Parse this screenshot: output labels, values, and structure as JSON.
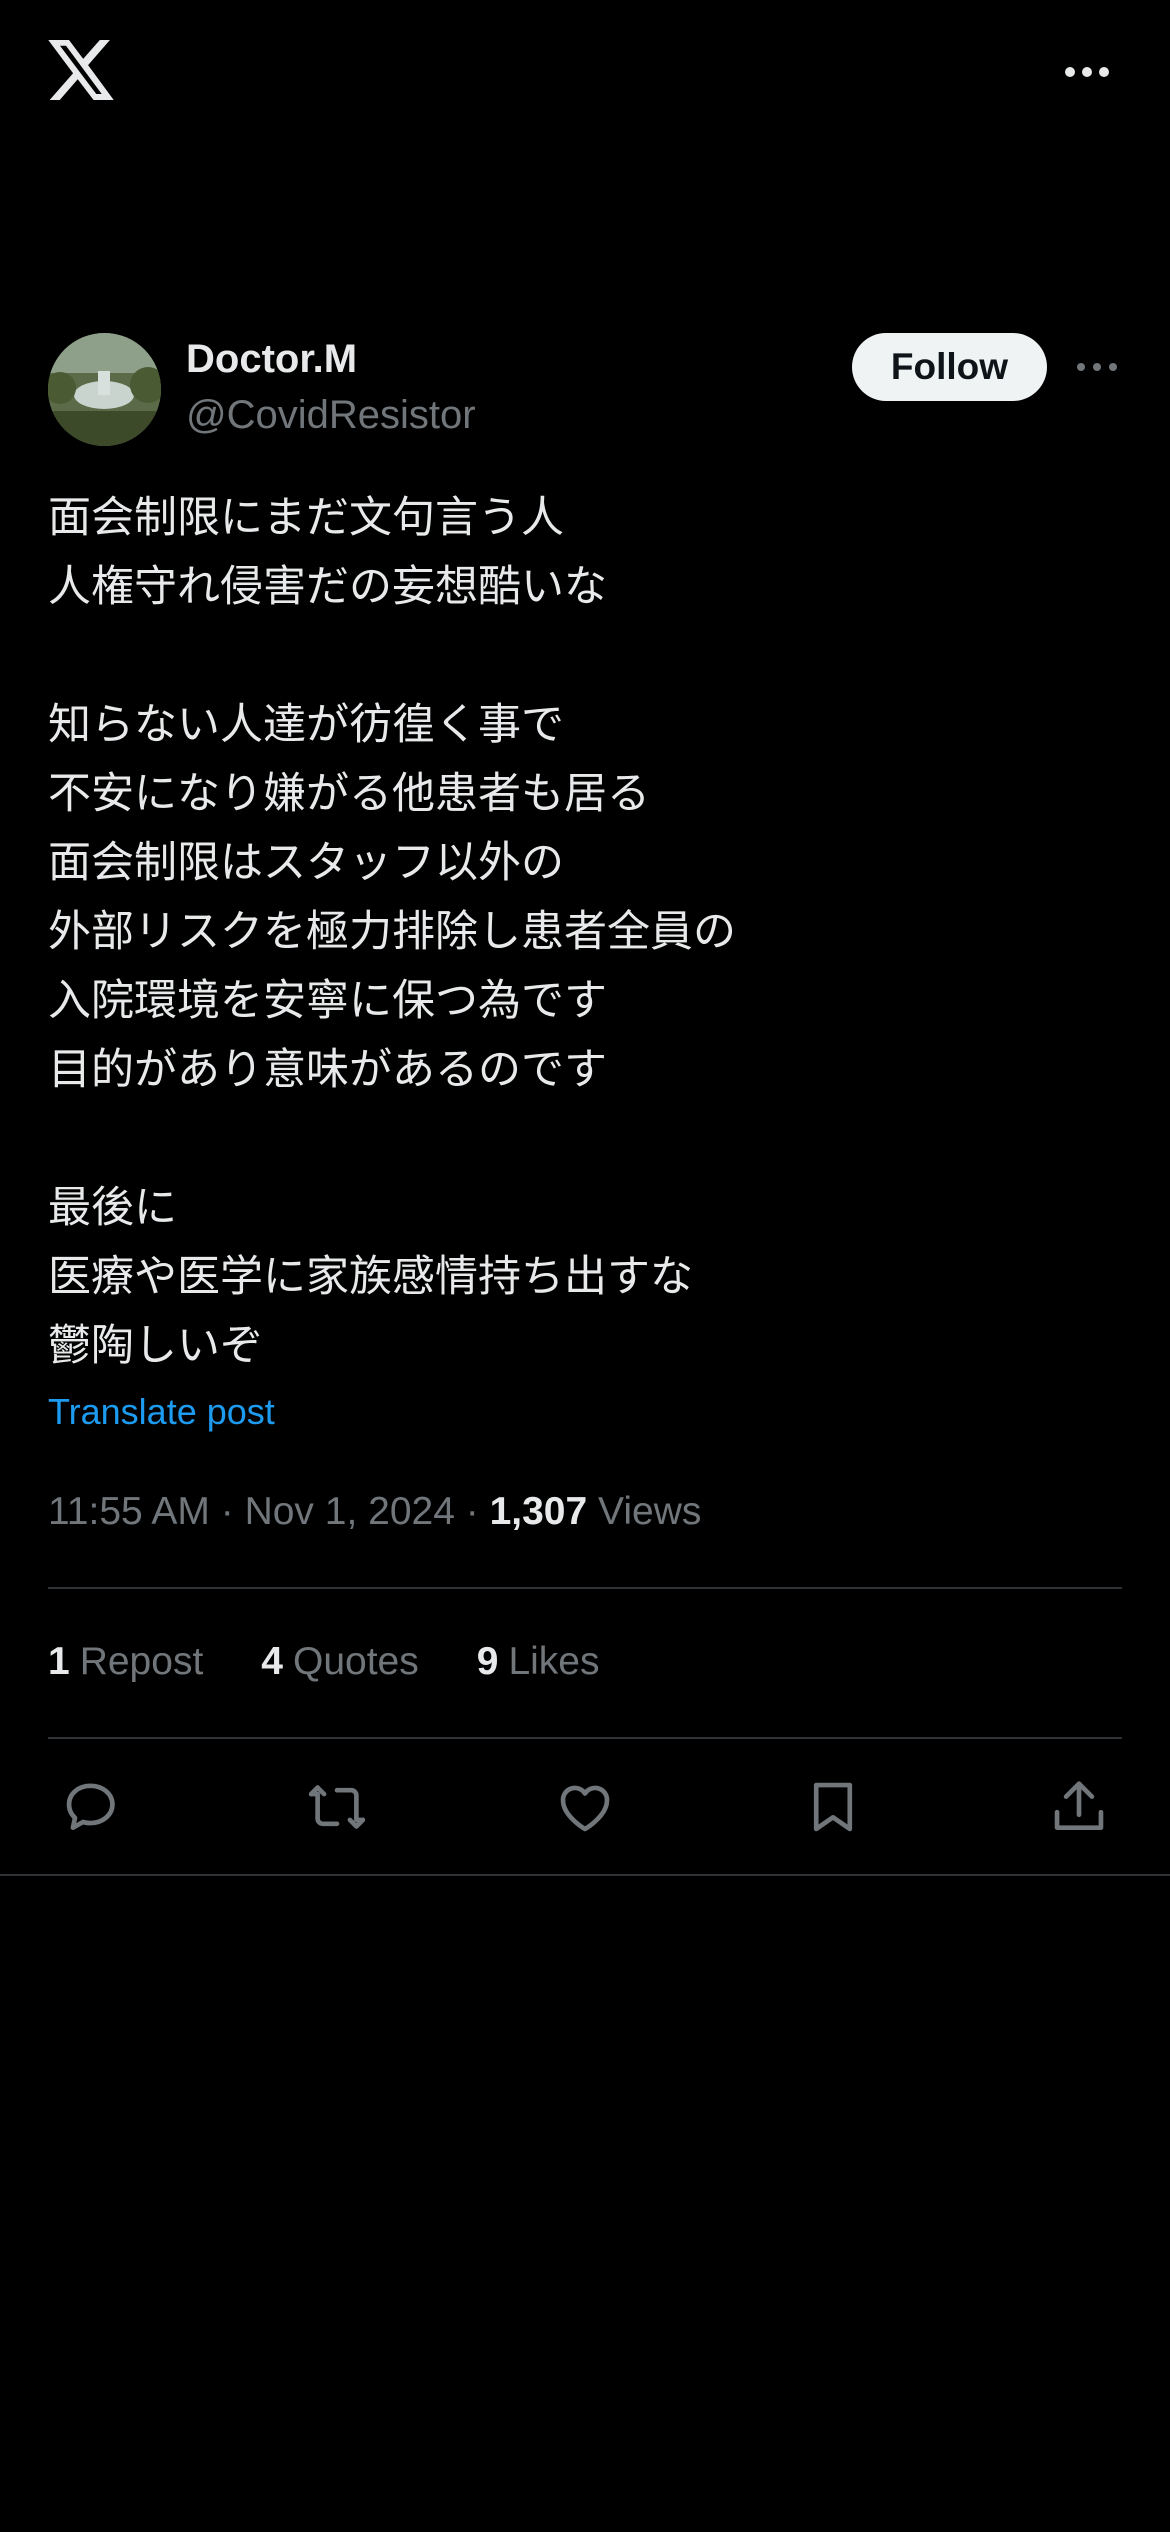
{
  "header": {
    "logo_icon": "x-logo-icon",
    "more_icon": "more-horizontal-icon"
  },
  "author": {
    "display_name": "Doctor.M",
    "handle": "@CovidResistor",
    "follow_label": "Follow"
  },
  "post": {
    "text": "面会制限にまだ文句言う人\n人権守れ侵害だの妄想酷いな\n\n知らない人達が彷徨く事で\n不安になり嫌がる他患者も居る\n面会制限はスタッフ以外の\n外部リスクを極力排除し患者全員の\n入院環境を安寧に保つ為です\n目的があり意味があるのです\n\n最後に\n医療や医学に家族感情持ち出すな\n鬱陶しいぞ",
    "translate_label": "Translate post",
    "time": "11:55 AM",
    "date": "Nov 1, 2024",
    "separator": "·",
    "views_count": "1,307",
    "views_label": "Views"
  },
  "stats": {
    "reposts_count": "1",
    "reposts_label": "Repost",
    "quotes_count": "4",
    "quotes_label": "Quotes",
    "likes_count": "9",
    "likes_label": "Likes"
  },
  "actions": [
    "reply-icon",
    "repost-icon",
    "like-icon",
    "bookmark-icon",
    "share-icon"
  ],
  "colors": {
    "background": "#000000",
    "text_primary": "#e7e9ea",
    "text_secondary": "#71767b",
    "link": "#1d9bf0",
    "divider": "#2f3336",
    "follow_bg": "#eff3f4"
  }
}
